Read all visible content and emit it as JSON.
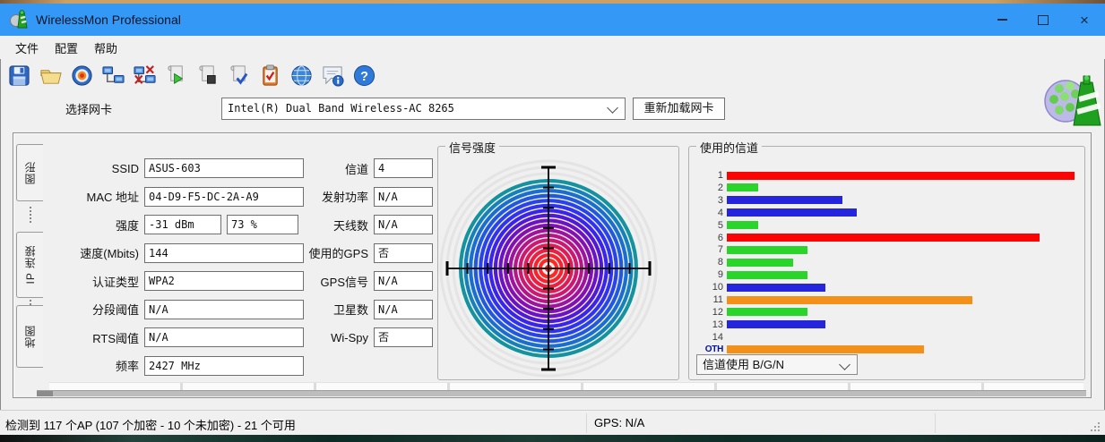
{
  "window": {
    "title": "WirelessMon Professional"
  },
  "menu": {
    "items": [
      "文件",
      "配置",
      "帮助"
    ]
  },
  "toolbar": {
    "icons": [
      "save-icon",
      "open-folder-icon",
      "target-icon",
      "network-connect-icon",
      "network-disconnect-icon",
      "script-run-icon",
      "script-stop-icon",
      "script-check-icon",
      "report-check-icon",
      "web-globe-icon",
      "feedback-info-icon",
      "help-icon"
    ]
  },
  "adapter": {
    "label": "选择网卡",
    "selected": "Intel(R) Dual Band Wireless-AC 8265",
    "reload_button": "重新加载网卡"
  },
  "sidebar": {
    "tabs": [
      {
        "label": "图形"
      },
      {
        "label": "IP 连接"
      },
      {
        "label": "地图"
      }
    ]
  },
  "summary": {
    "left_fields": [
      {
        "label": "SSID",
        "values": [
          "ASUS-603"
        ]
      },
      {
        "label": "MAC 地址",
        "values": [
          "04-D9-F5-DC-2A-A9"
        ]
      },
      {
        "label": "强度",
        "values": [
          "-31 dBm",
          "73 %"
        ]
      },
      {
        "label": "速度(Mbits)",
        "values": [
          "144"
        ]
      },
      {
        "label": "认证类型",
        "values": [
          "WPA2"
        ]
      },
      {
        "label": "分段阈值",
        "values": [
          "N/A"
        ]
      },
      {
        "label": "RTS阈值",
        "values": [
          "N/A"
        ]
      },
      {
        "label": "频率",
        "values": [
          "2427 MHz"
        ]
      }
    ],
    "right_fields": [
      {
        "label": "信道",
        "values": [
          "4"
        ]
      },
      {
        "label": "发射功率",
        "values": [
          "N/A"
        ]
      },
      {
        "label": "天线数",
        "values": [
          "N/A"
        ]
      },
      {
        "label": "使用的GPS",
        "values": [
          "否"
        ]
      },
      {
        "label": "GPS信号",
        "values": [
          "N/A"
        ]
      },
      {
        "label": "卫星数",
        "values": [
          "N/A"
        ]
      },
      {
        "label": "Wi-Spy",
        "values": [
          "否"
        ]
      }
    ]
  },
  "channel_selector": {
    "value": "信道使用 B/G/N"
  },
  "status_bar": {
    "detect_text": "检测到 117 个AP (107 个加密 - 10 个未加密) - 21 个可用",
    "gps_text": "GPS: N/A"
  },
  "chart_data": [
    {
      "type": "radial-gauge",
      "title": "信号强度",
      "represents": "current signal strength bullseye (stronger = more rings filled toward red center)",
      "value_dbm": "-31 dBm",
      "value_percent": "73 %",
      "outer_faint_ring_color": "#e4e4e4",
      "ring_colors_outer_to_inner": [
        "#14929e",
        "#1581b8",
        "#1a6ecd",
        "#2059de",
        "#2844e8",
        "#3032ee",
        "#3b24e9",
        "#5019d6",
        "#6a12c4",
        "#8410b2",
        "#9e129e",
        "#b61587",
        "#cc1870",
        "#de1b57",
        "#ec1e41",
        "#f7222f",
        "#ff2722"
      ],
      "center_color": "#ff2020",
      "crosshair_color": "#000000"
    },
    {
      "type": "bar",
      "orientation": "horizontal",
      "title": "使用的信道",
      "categories": [
        "1",
        "2",
        "3",
        "4",
        "5",
        "6",
        "7",
        "8",
        "9",
        "10",
        "11",
        "12",
        "13",
        "14",
        "OTH"
      ],
      "values": [
        99,
        9,
        33,
        37,
        9,
        89,
        23,
        19,
        23,
        28,
        70,
        23,
        28,
        0,
        56
      ],
      "value_unit": "relative channel usage, percent of plot width",
      "bar_colors": [
        "#fb0404",
        "#2ad42a",
        "#2525dd",
        "#2525dd",
        "#2ad42a",
        "#fb0404",
        "#2ad42a",
        "#2ad42a",
        "#2ad42a",
        "#2525dd",
        "#f39019",
        "#2ad42a",
        "#2525dd",
        "",
        "#f39019"
      ],
      "xlim": [
        0,
        100
      ],
      "grid": false,
      "legend": null
    }
  ],
  "colors": {
    "titlebar": "#3498f7",
    "chrome_bg": "#f0f0f0",
    "accent_red": "#fb0404",
    "accent_green": "#2ad42a",
    "accent_blue": "#2525dd",
    "accent_orange": "#f39019"
  }
}
